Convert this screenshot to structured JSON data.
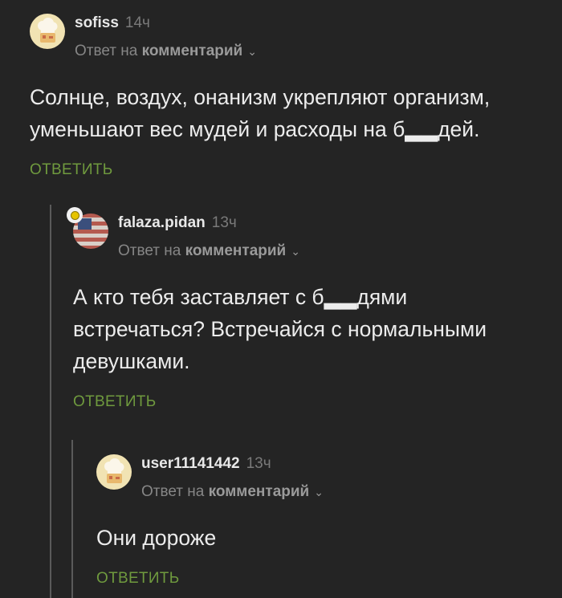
{
  "comments": [
    {
      "username": "sofiss",
      "time": "14ч",
      "reply_prefix": "Ответ на",
      "reply_target": "комментарий",
      "text": "Солнце, воздух, онанизм укрепляют организм, уменьшают вес мудей и расходы на б▂▂дей.",
      "action": "ОТВЕТИТЬ",
      "avatar_icon": "chef-hat-icon"
    },
    {
      "username": "falaza.pidan",
      "time": "13ч",
      "reply_prefix": "Ответ на",
      "reply_target": "комментарий",
      "text": "А кто тебя заставляет с б▂▂дями встречаться? Встречайся с нормальными девушками.",
      "action": "ОТВЕТИТЬ",
      "avatar_icon": "flag-icon"
    },
    {
      "username": "user11141442",
      "time": "13ч",
      "reply_prefix": "Ответ на",
      "reply_target": "комментарий",
      "text": "Они дороже",
      "action": "ОТВЕТИТЬ",
      "avatar_icon": "chef-hat-icon"
    }
  ],
  "colors": {
    "background": "#242424",
    "accent": "#6f9a3e",
    "muted": "#868686",
    "text": "#ececec"
  }
}
